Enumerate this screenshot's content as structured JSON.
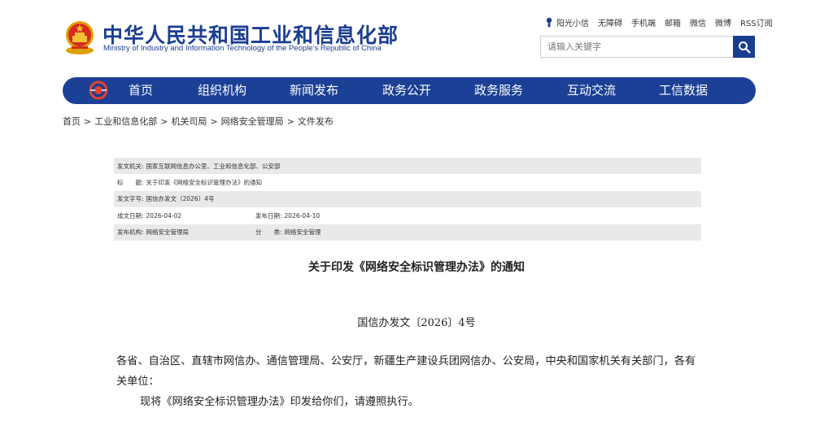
{
  "header": {
    "title_cn": "中华人民共和国工业和信息化部",
    "title_en": "Ministry of Industry and Information Technology of the People’s Republic of China",
    "links": [
      "阳光小信",
      "无障碍",
      "手机端",
      "邮箱",
      "微信",
      "微博",
      "RSS订阅"
    ],
    "search_placeholder": "请输入关键字",
    "brand_color": "#1a3d91"
  },
  "nav": {
    "items": [
      "首页",
      "组织机构",
      "新闻发布",
      "政务公开",
      "政务服务",
      "互动交流",
      "工信数据"
    ]
  },
  "breadcrumb": [
    "首页",
    "工业和信息化部",
    "机关司局",
    "网络安全管理局",
    "文件发布"
  ],
  "meta": {
    "issuer_label": "发文机关:",
    "issuer": "国家互联网信息办公室、工业和信息化部、公安部",
    "title_label": "标　　题:",
    "title": "关于印发《网络安全标识管理办法》的通知",
    "docno_label": "发文字号:",
    "docno": "国信办发文〔2026〕4号",
    "date_label": "成文日期:",
    "date": "2026-04-02",
    "pubdate_label": "发布日期:",
    "pubdate": "2026-04-10",
    "org_label": "发布机构:",
    "org": "网络安全管理局",
    "category_label": "分　　类:",
    "category": "网络安全管理"
  },
  "document": {
    "title": "关于印发《网络安全标识管理办法》的通知",
    "number": "国信办发文〔2026〕4号",
    "recipients": "各省、自治区、直辖市网信办、通信管理局、公安厅，新疆生产建设兵团网信办、公安局，中央和国家机关有关部门，各有关单位：",
    "body_1": "现将《网络安全标识管理办法》印发给你们，请遵照执行。"
  }
}
